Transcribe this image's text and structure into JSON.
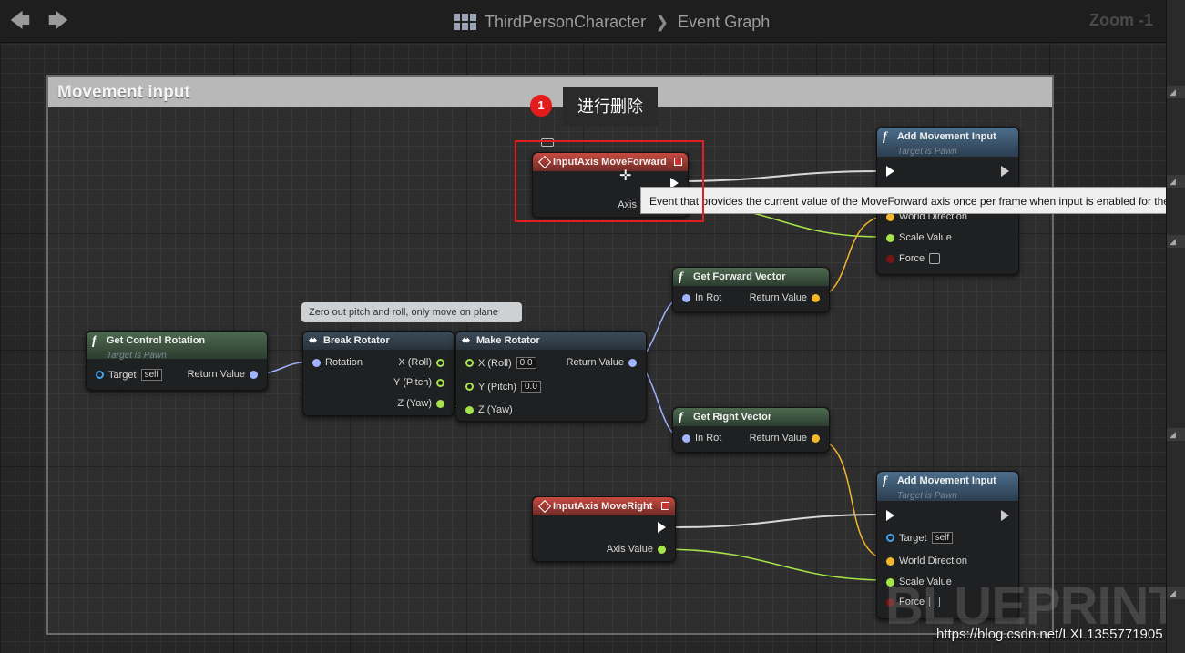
{
  "toolbar": {
    "back_icon": "back-arrow-icon",
    "forward_icon": "forward-arrow-icon",
    "breadcrumb_asset": "ThirdPersonCharacter",
    "breadcrumb_graph": "Event Graph",
    "zoom": "Zoom -1"
  },
  "comment": {
    "title": "Movement input"
  },
  "annotation": {
    "badge": "1",
    "callout": "进行删除"
  },
  "tooltip": "Event that provides the current value of the MoveForward axis once per frame when input is enabled for the co",
  "comment_bubble": "Zero out pitch and roll, only move on plane",
  "nodes": {
    "input_move_forward": {
      "title": "InputAxis MoveForward",
      "pin_axis": "Axis"
    },
    "input_move_right": {
      "title": "InputAxis MoveRight",
      "pin_axis": "Axis Value"
    },
    "add_movement_1": {
      "title": "Add Movement Input",
      "subtitle": "Target is Pawn",
      "pin_world": "World Direction",
      "pin_scale": "Scale Value",
      "pin_force": "Force"
    },
    "add_movement_2": {
      "title": "Add Movement Input",
      "subtitle": "Target is Pawn",
      "pin_target": "Target",
      "target_value": "self",
      "pin_world": "World Direction",
      "pin_scale": "Scale Value",
      "pin_force": "Force"
    },
    "get_forward": {
      "title": "Get Forward Vector",
      "pin_in": "In Rot",
      "pin_out": "Return Value"
    },
    "get_right": {
      "title": "Get Right Vector",
      "pin_in": "In Rot",
      "pin_out": "Return Value"
    },
    "get_control_rotation": {
      "title": "Get Control Rotation",
      "subtitle": "Target is Pawn",
      "pin_target": "Target",
      "target_value": "self",
      "pin_out": "Return Value"
    },
    "break_rotator": {
      "title": "Break Rotator",
      "pin_in": "Rotation",
      "pin_x": "X (Roll)",
      "pin_y": "Y (Pitch)",
      "pin_z": "Z (Yaw)"
    },
    "make_rotator": {
      "title": "Make Rotator",
      "pin_x": "X (Roll)",
      "x_value": "0.0",
      "pin_y": "Y (Pitch)",
      "y_value": "0.0",
      "pin_z": "Z (Yaw)",
      "pin_out": "Return Value"
    }
  },
  "watermark": "BLUEPRINT",
  "source_url": "https://blog.csdn.net/LXL1355771905",
  "colors": {
    "exec": "#ffffff",
    "float": "#a6e34a",
    "rotator": "#a0b4ff",
    "vector": "#f2b72b",
    "object": "#3fa4f0",
    "highlight": "#e02020"
  }
}
